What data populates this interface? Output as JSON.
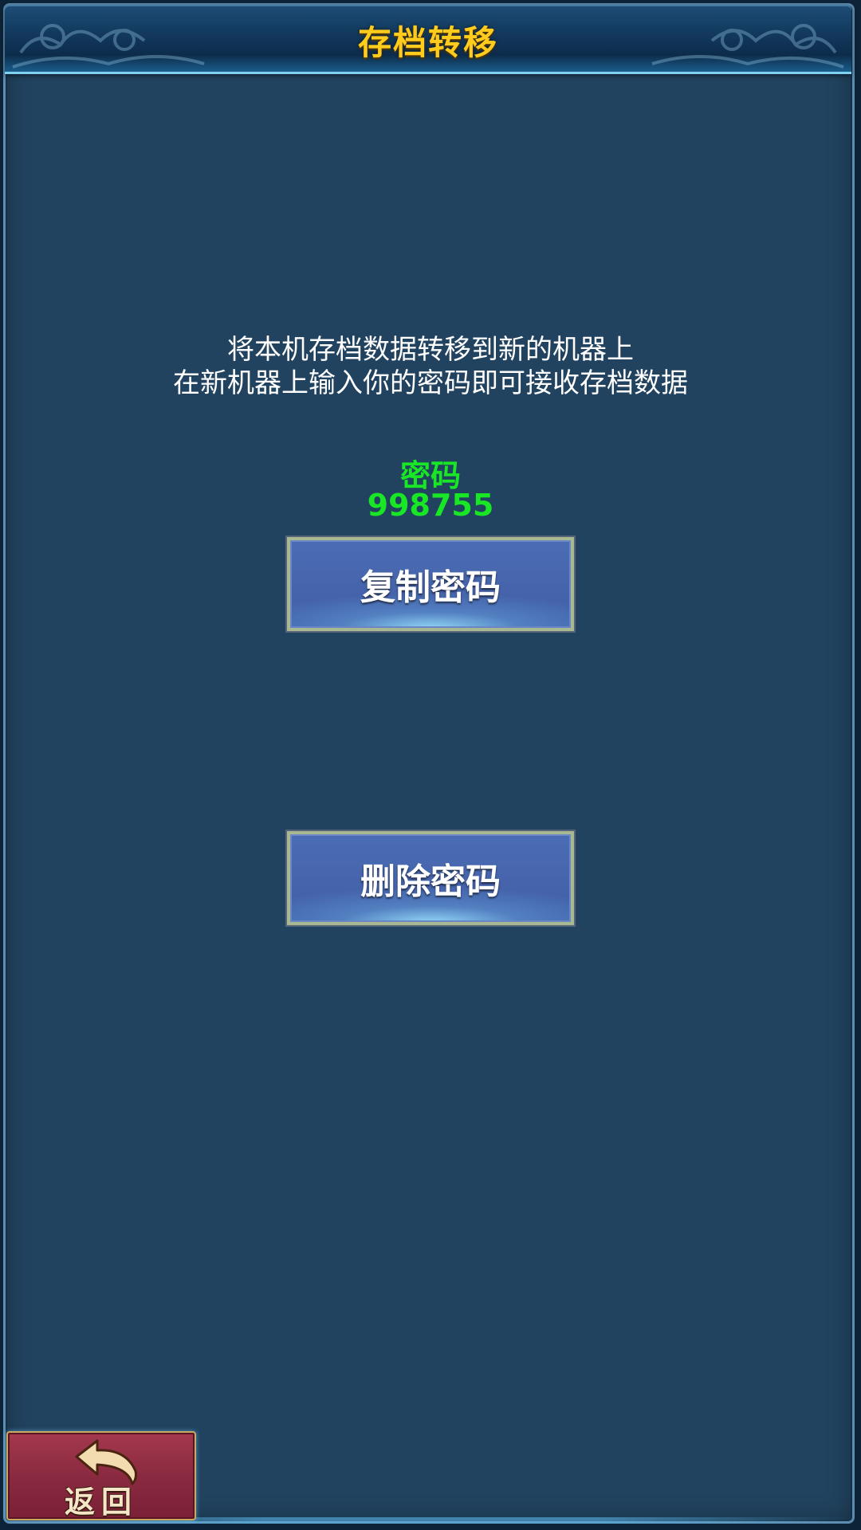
{
  "header": {
    "title": "存档转移"
  },
  "description": {
    "line1": "将本机存档数据转移到新的机器上",
    "line2": "在新机器上输入你的密码即可接收存档数据"
  },
  "password": {
    "label": "密码",
    "value": "998755"
  },
  "buttons": {
    "copy_label": "复制密码",
    "delete_label": "删除密码",
    "back_label": "返回"
  },
  "colors": {
    "title": "#ffcc1e",
    "password": "#19e625",
    "panel": "#21435f",
    "button": "#4664ab",
    "back_button": "#8a2a40"
  },
  "icons": {
    "back": "return-arrow-icon",
    "header_ornament": "cloud-ornament-icon"
  }
}
